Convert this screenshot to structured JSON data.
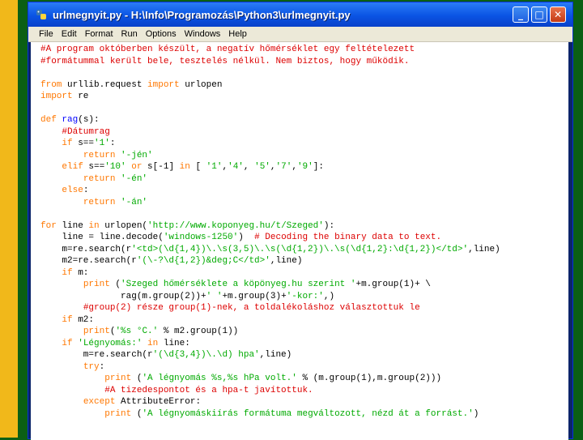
{
  "window": {
    "title": "urlmegnyit.py - H:\\Info\\Programozás\\Python3\\urlmegnyit.py",
    "icon": "python-file-icon",
    "buttons": {
      "minimize": "_",
      "maximize": "□",
      "close": "✕"
    }
  },
  "menu": {
    "items": [
      "File",
      "Edit",
      "Format",
      "Run",
      "Options",
      "Windows",
      "Help"
    ]
  },
  "code": {
    "lines": [
      [
        {
          "t": "#A program októberben készült, a negatív hőmérséklet egy feltételezett",
          "c": "cm"
        }
      ],
      [
        {
          "t": "#formátummal került bele, tesztelés nélkül. Nem biztos, hogy működik.",
          "c": "cm"
        }
      ],
      [],
      [
        {
          "t": "from",
          "c": "kw"
        },
        {
          "t": " urllib.request "
        },
        {
          "t": "import",
          "c": "kw"
        },
        {
          "t": " urlopen"
        }
      ],
      [
        {
          "t": "import",
          "c": "kw"
        },
        {
          "t": " re"
        }
      ],
      [],
      [
        {
          "t": "def",
          "c": "kw"
        },
        {
          "t": " "
        },
        {
          "t": "rag",
          "c": "df"
        },
        {
          "t": "(s):"
        }
      ],
      [
        {
          "t": "    "
        },
        {
          "t": "#Dátumrag",
          "c": "cm"
        }
      ],
      [
        {
          "t": "    "
        },
        {
          "t": "if",
          "c": "kw"
        },
        {
          "t": " s=="
        },
        {
          "t": "'1'",
          "c": "st"
        },
        {
          "t": ":"
        }
      ],
      [
        {
          "t": "        "
        },
        {
          "t": "return",
          "c": "kw"
        },
        {
          "t": " "
        },
        {
          "t": "'-jén'",
          "c": "st"
        }
      ],
      [
        {
          "t": "    "
        },
        {
          "t": "elif",
          "c": "kw"
        },
        {
          "t": " s=="
        },
        {
          "t": "'10'",
          "c": "st"
        },
        {
          "t": " "
        },
        {
          "t": "or",
          "c": "kw"
        },
        {
          "t": " s[-1] "
        },
        {
          "t": "in",
          "c": "kw"
        },
        {
          "t": " [ "
        },
        {
          "t": "'1'",
          "c": "st"
        },
        {
          "t": ","
        },
        {
          "t": "'4'",
          "c": "st"
        },
        {
          "t": ", "
        },
        {
          "t": "'5'",
          "c": "st"
        },
        {
          "t": ","
        },
        {
          "t": "'7'",
          "c": "st"
        },
        {
          "t": ","
        },
        {
          "t": "'9'",
          "c": "st"
        },
        {
          "t": "]:"
        }
      ],
      [
        {
          "t": "        "
        },
        {
          "t": "return",
          "c": "kw"
        },
        {
          "t": " "
        },
        {
          "t": "'-én'",
          "c": "st"
        }
      ],
      [
        {
          "t": "    "
        },
        {
          "t": "else",
          "c": "kw"
        },
        {
          "t": ":"
        }
      ],
      [
        {
          "t": "        "
        },
        {
          "t": "return",
          "c": "kw"
        },
        {
          "t": " "
        },
        {
          "t": "'-án'",
          "c": "st"
        }
      ],
      [],
      [
        {
          "t": "for",
          "c": "kw"
        },
        {
          "t": " line "
        },
        {
          "t": "in",
          "c": "kw"
        },
        {
          "t": " urlopen("
        },
        {
          "t": "'http://www.koponyeg.hu/t/Szeged'",
          "c": "st"
        },
        {
          "t": "):"
        }
      ],
      [
        {
          "t": "    line = line.decode("
        },
        {
          "t": "'windows-1250'",
          "c": "st"
        },
        {
          "t": ")  "
        },
        {
          "t": "# Decoding the binary data to text.",
          "c": "cm"
        }
      ],
      [
        {
          "t": "    m=re.search(r"
        },
        {
          "t": "'<td>(\\d{1,4})\\.\\s(3,5)\\.\\s(\\d{1,2})\\.\\s(\\d{1,2}:\\d{1,2})</td>'",
          "c": "st"
        },
        {
          "t": ",line)"
        }
      ],
      [
        {
          "t": "    m2=re.search(r"
        },
        {
          "t": "'(\\-?\\d{1,2})&deg;C</td>'",
          "c": "st"
        },
        {
          "t": ",line)"
        }
      ],
      [
        {
          "t": "    "
        },
        {
          "t": "if",
          "c": "kw"
        },
        {
          "t": " m:"
        }
      ],
      [
        {
          "t": "        "
        },
        {
          "t": "print",
          "c": "kw"
        },
        {
          "t": " ("
        },
        {
          "t": "'Szeged hőmérséklete a köpönyeg.hu szerint '",
          "c": "st"
        },
        {
          "t": "+m.group(1)+ \\"
        }
      ],
      [
        {
          "t": "               rag(m.group(2))+"
        },
        {
          "t": "' '",
          "c": "st"
        },
        {
          "t": "+m.group(3)+"
        },
        {
          "t": "'-kor:'",
          "c": "st"
        },
        {
          "t": ",)"
        }
      ],
      [
        {
          "t": "        "
        },
        {
          "t": "#group(2) része group(1)-nek, a toldalékoláshoz választottuk le",
          "c": "cm"
        }
      ],
      [
        {
          "t": "    "
        },
        {
          "t": "if",
          "c": "kw"
        },
        {
          "t": " m2:"
        }
      ],
      [
        {
          "t": "        "
        },
        {
          "t": "print",
          "c": "kw"
        },
        {
          "t": "("
        },
        {
          "t": "'%s °C.'",
          "c": "st"
        },
        {
          "t": " % m2.group(1))"
        }
      ],
      [
        {
          "t": "    "
        },
        {
          "t": "if",
          "c": "kw"
        },
        {
          "t": " "
        },
        {
          "t": "'Légnyomás:'",
          "c": "st"
        },
        {
          "t": " "
        },
        {
          "t": "in",
          "c": "kw"
        },
        {
          "t": " line:"
        }
      ],
      [
        {
          "t": "        m=re.search(r"
        },
        {
          "t": "'(\\d{3,4})\\.\\d) hpa'",
          "c": "st"
        },
        {
          "t": ",line)"
        }
      ],
      [
        {
          "t": "        "
        },
        {
          "t": "try",
          "c": "kw"
        },
        {
          "t": ":"
        }
      ],
      [
        {
          "t": "            "
        },
        {
          "t": "print",
          "c": "kw"
        },
        {
          "t": " ("
        },
        {
          "t": "'A légnyomás %s,%s hPa volt.'",
          "c": "st"
        },
        {
          "t": " % (m.group(1),m.group(2)))"
        }
      ],
      [
        {
          "t": "            "
        },
        {
          "t": "#A tizedespontot és a hpa-t javítottuk.",
          "c": "cm"
        }
      ],
      [
        {
          "t": "        "
        },
        {
          "t": "except",
          "c": "kw"
        },
        {
          "t": " AttributeError:"
        }
      ],
      [
        {
          "t": "            "
        },
        {
          "t": "print",
          "c": "kw"
        },
        {
          "t": " ("
        },
        {
          "t": "'A légnyomáskiírás formátuma megváltozott, nézd át a forrást.'",
          "c": "st"
        },
        {
          "t": ")"
        }
      ]
    ]
  },
  "colors": {
    "keyword": "#ff7700",
    "comment": "#dd0000",
    "string": "#00aa00",
    "definition": "#0000ff",
    "desktop": "#0b5f14",
    "stripe": "#f1b81a"
  }
}
